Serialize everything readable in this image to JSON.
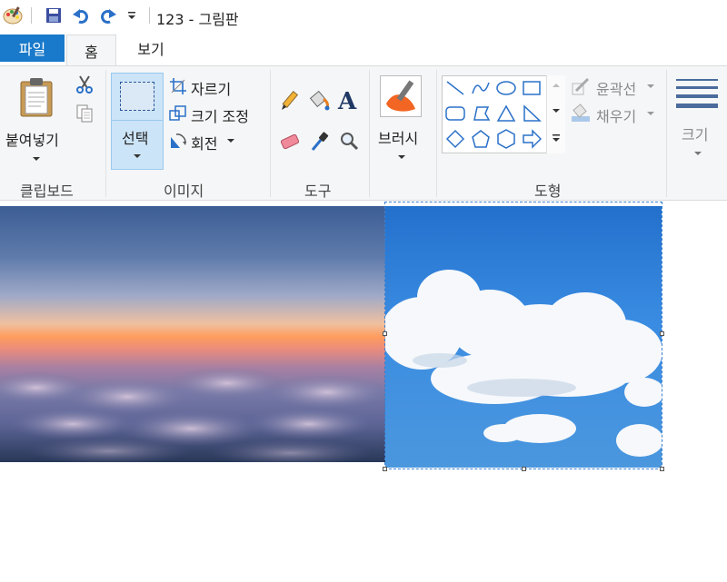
{
  "window": {
    "title": "123 - 그림판"
  },
  "tabs": {
    "file": "파일",
    "home": "홈",
    "view": "보기"
  },
  "clipboard": {
    "paste_label": "붙여넣기",
    "group_label": "클립보드"
  },
  "image": {
    "select_label": "선택",
    "crop_label": "자르기",
    "resize_label": "크기 조정",
    "rotate_label": "회전",
    "group_label": "이미지"
  },
  "tools": {
    "group_label": "도구",
    "text_glyph": "A"
  },
  "brushes": {
    "label": "브러시"
  },
  "shapes": {
    "outline_label": "윤곽선",
    "fill_label": "채우기",
    "group_label": "도형"
  },
  "size": {
    "label": "크기"
  },
  "colors": {
    "accent": "#1979ca",
    "ribbon_bg": "#f5f6f7",
    "selection": "#cce4f7"
  }
}
